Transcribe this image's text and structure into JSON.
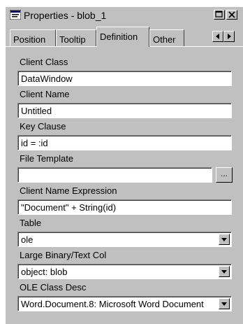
{
  "window": {
    "title": "Properties - blob_1"
  },
  "tabs": [
    {
      "label": "Position"
    },
    {
      "label": "Tooltip"
    },
    {
      "label": "Definition"
    },
    {
      "label": "Other"
    }
  ],
  "fields": {
    "client_class": {
      "label": "Client Class",
      "value": "DataWindow"
    },
    "client_name": {
      "label": "Client Name",
      "value": "Untitled"
    },
    "key_clause": {
      "label": "Key Clause",
      "value": "id = :id"
    },
    "file_template": {
      "label": "File Template",
      "value": "",
      "browse_label": "..."
    },
    "client_name_expression": {
      "label": "Client Name Expression",
      "value": "\"Document\" + String(id)"
    },
    "table": {
      "label": "Table",
      "value": "ole"
    },
    "large_binary_text_col": {
      "label": "Large Binary/Text Col",
      "value": "object: blob"
    },
    "ole_class_desc": {
      "label": "OLE Class Desc",
      "value": "Word.Document.8: Microsoft Word Document"
    }
  }
}
